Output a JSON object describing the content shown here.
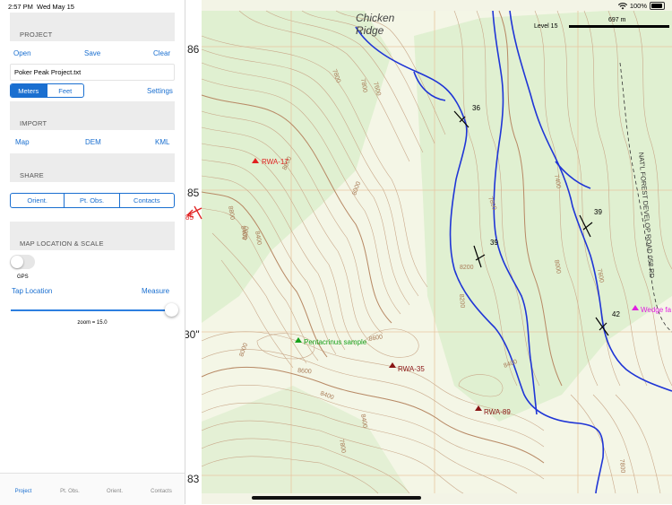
{
  "status": {
    "time": "2:57 PM",
    "date": "Wed May 15",
    "battery": "100%"
  },
  "project": {
    "header": "PROJECT",
    "open": "Open",
    "save": "Save",
    "clear": "Clear",
    "file_name": "Poker Peak Project.txt"
  },
  "units": {
    "options": [
      "Meters",
      "Feet"
    ],
    "selected": "Meters",
    "settings": "Settings"
  },
  "import": {
    "header": "IMPORT",
    "map": "Map",
    "dem": "DEM",
    "kml": "KML"
  },
  "share": {
    "header": "SHARE",
    "options": [
      "Orient.",
      "Pt. Obs.",
      "Contacts"
    ]
  },
  "location": {
    "header": "MAP LOCATION & SCALE",
    "gps_label": "GPS",
    "tap_location": "Tap Location",
    "measure": "Measure",
    "zoom_text": "zoom = 15.0",
    "zoom_level": 15.0,
    "gps_on": false
  },
  "tabs": [
    {
      "label": "Project",
      "active": true
    },
    {
      "label": "Pt. Obs.",
      "active": false
    },
    {
      "label": "Orient.",
      "active": false
    },
    {
      "label": "Contacts",
      "active": false
    }
  ],
  "map": {
    "level_label": "Level 15",
    "scale_label": "697 m",
    "place_labels": [
      "Chicken",
      "Ridge"
    ],
    "road_label": "NAT'L FOREST DEVELOP ROAD 058 RD",
    "grid_labels": [
      "86",
      "85",
      "30\"",
      "83"
    ],
    "contour_labels": [
      "7800",
      "7600",
      "8000",
      "8200",
      "8400",
      "8600",
      "8000",
      "8400",
      "8600",
      "8400",
      "8800",
      "7800",
      "8200",
      "8000",
      "8400",
      "7800",
      "8000",
      "7400",
      "7600",
      "7800",
      "8200",
      "8400",
      "7800"
    ],
    "points": [
      {
        "label": "RWA-17",
        "color": "#e02020",
        "kind": "triangle"
      },
      {
        "label": "Pentacrinus sample",
        "color": "#17a11b",
        "kind": "triangle"
      },
      {
        "label": "RWA-35",
        "color": "#8a1515",
        "kind": "triangle"
      },
      {
        "label": "RWA-89",
        "color": "#8a1515",
        "kind": "triangle"
      },
      {
        "label": "Wedge fa",
        "color": "#e020e0",
        "kind": "triangle"
      },
      {
        "label": "85",
        "color": "#e02020",
        "kind": "arrow"
      }
    ],
    "orientations": [
      {
        "label": "36"
      },
      {
        "label": "39"
      },
      {
        "label": "39"
      },
      {
        "label": "42"
      }
    ],
    "colors": {
      "contour": "#c9a88a",
      "stream": "#1f35d6",
      "grid": "#e8c7a0",
      "background": "#f3f4e6"
    }
  }
}
